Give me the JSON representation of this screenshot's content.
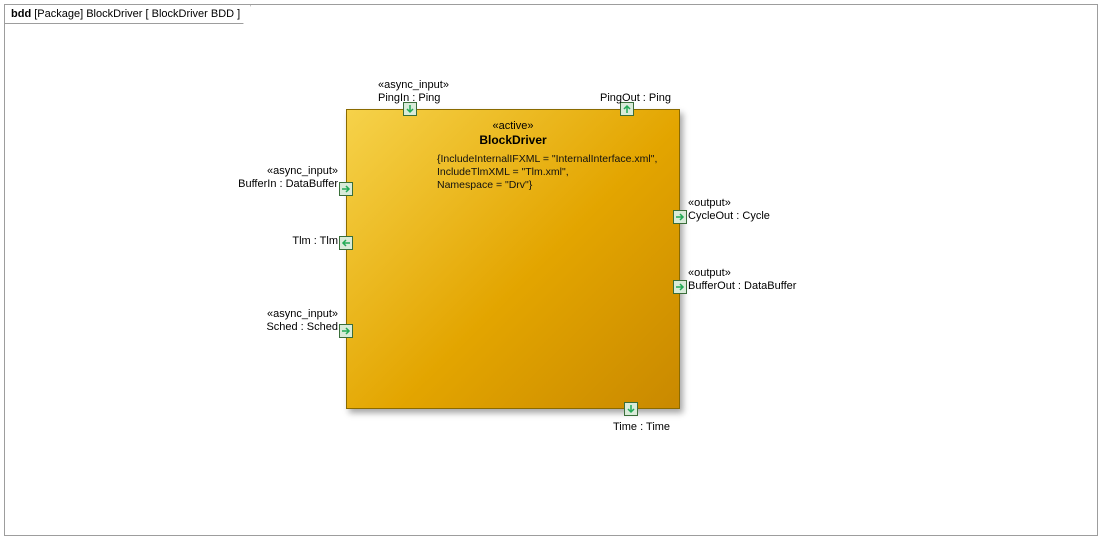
{
  "frame": {
    "kind_bold": "bdd",
    "kind_rest": " [Package] BlockDriver [ BlockDriver BDD ]"
  },
  "block": {
    "stereotype": "«active»",
    "name": "BlockDriver",
    "props_line1": "{IncludeInternalIFXML = \"InternalInterface.xml\",",
    "props_line2": "IncludeTlmXML = \"Tlm.xml\",",
    "props_line3": "Namespace = \"Drv\"}"
  },
  "ports": {
    "pingIn": {
      "stereo": "«async_input»",
      "label": "PingIn : Ping"
    },
    "pingOut": {
      "stereo": "",
      "label": "PingOut : Ping"
    },
    "bufferIn": {
      "stereo": "«async_input»",
      "label": "BufferIn : DataBuffer"
    },
    "tlm": {
      "stereo": "",
      "label": "Tlm : Tlm"
    },
    "sched": {
      "stereo": "«async_input»",
      "label": "Sched : Sched"
    },
    "cycleOut": {
      "stereo": "«output»",
      "label": "CycleOut : Cycle"
    },
    "bufferOut": {
      "stereo": "«output»",
      "label": "BufferOut : DataBuffer"
    },
    "time": {
      "stereo": "",
      "label": "Time : Time"
    }
  }
}
